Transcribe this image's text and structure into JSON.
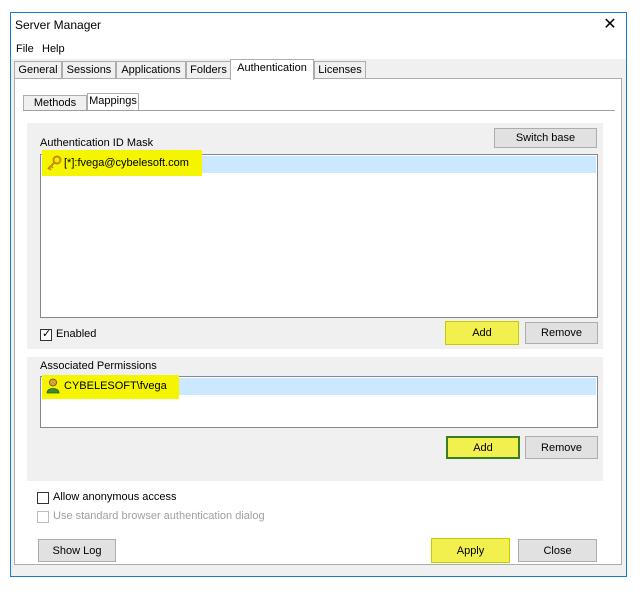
{
  "window": {
    "title": "Server Manager"
  },
  "menu": [
    "File",
    "Help"
  ],
  "tabs": [
    "General",
    "Sessions",
    "Applications",
    "Folders",
    "Authentication",
    "Licenses"
  ],
  "subtabs": [
    "Methods",
    "Mappings"
  ],
  "auth_section": {
    "label": "Authentication ID Mask",
    "switch_base": "Switch base",
    "entries": [
      {
        "text": "[*]:fvega@cybelesoft.com",
        "icon": "key-icon"
      }
    ],
    "enabled_label": "Enabled",
    "enabled_checked": true,
    "add_label": "Add",
    "remove_label": "Remove"
  },
  "permissions_section": {
    "label": "Associated Permissions",
    "entries": [
      {
        "text": "CYBELESOFT\\fvega",
        "icon": "user-icon"
      }
    ],
    "add_label": "Add",
    "remove_label": "Remove"
  },
  "options": {
    "anonymous_label": "Allow anonymous access",
    "anonymous_checked": false,
    "browser_dialog_label": "Use standard browser authentication dialog",
    "browser_dialog_enabled": false
  },
  "footer": {
    "show_log": "Show Log",
    "apply": "Apply",
    "close": "Close"
  },
  "colors": {
    "highlight": "#f5f500",
    "selection": "#cce8ff",
    "window_border": "#1979ca"
  }
}
